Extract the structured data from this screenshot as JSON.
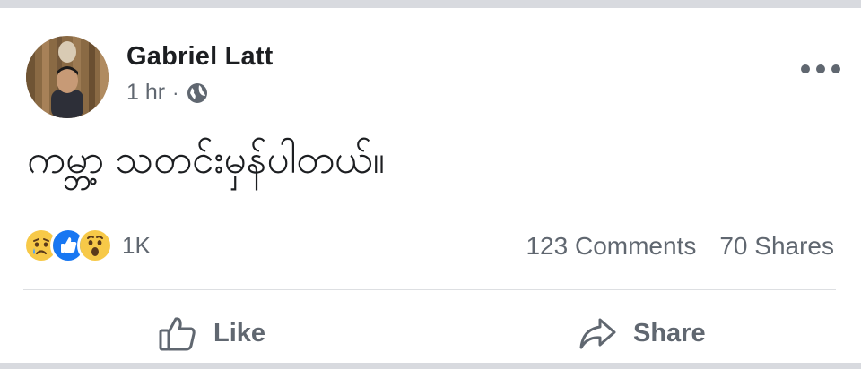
{
  "post": {
    "author": "Gabriel Latt",
    "time": "1 hr",
    "separator": "·",
    "privacy_icon": "globe-icon",
    "more_icon": "more-horizontal-icon",
    "message": "ကမ္ဘာ့ သတင်းမှန်ပါတယ်။"
  },
  "reactions": {
    "icons": [
      "sad-reaction-icon",
      "like-reaction-icon",
      "wow-reaction-icon"
    ],
    "count": "1K"
  },
  "stats": {
    "comments": "123 Comments",
    "shares": "70 Shares"
  },
  "actions": {
    "like_label": "Like",
    "like_icon": "thumbs-up-icon",
    "share_label": "Share",
    "share_icon": "share-arrow-icon"
  },
  "colors": {
    "text_primary": "#1c1e21",
    "text_secondary": "#606770",
    "like_blue": "#1877f2",
    "reaction_yellow": "#f7c948",
    "divider": "#dddfe2",
    "band": "#d8dadf"
  }
}
